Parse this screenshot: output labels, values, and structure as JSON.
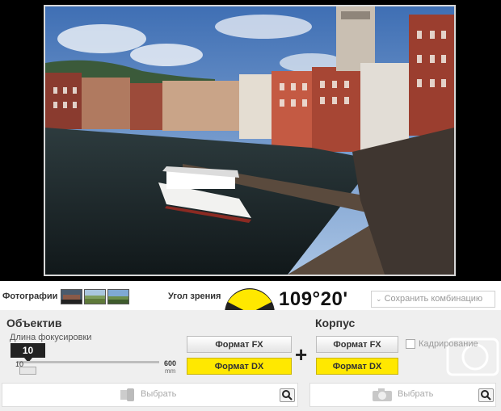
{
  "photos": {
    "label": "Фотографии",
    "thumbnails": [
      "city-photo-thumbnail",
      "landscape-photo-thumbnail",
      "field-photo-thumbnail"
    ]
  },
  "angle": {
    "label": "Угол зрения",
    "value": "109°20'"
  },
  "save": {
    "label": "Сохранить комбинацию"
  },
  "lens": {
    "title": "Объектив",
    "focal_label": "Длина фокусировки",
    "focal_value": "10",
    "slider_min": "10",
    "slider_max": "600",
    "slider_unit": "mm",
    "slider_level": 0,
    "fx_label": "Формат FX",
    "dx_label": "Формат DX",
    "select_label": "Выбрать"
  },
  "body": {
    "title": "Корпус",
    "fx_label": "Формат FX",
    "dx_label": "Формат DX",
    "crop_label": "Кадрирование",
    "select_label": "Выбрать"
  },
  "plus_symbol": "+",
  "colors": {
    "accent_yellow": "#ffe800",
    "dark": "#222222"
  }
}
